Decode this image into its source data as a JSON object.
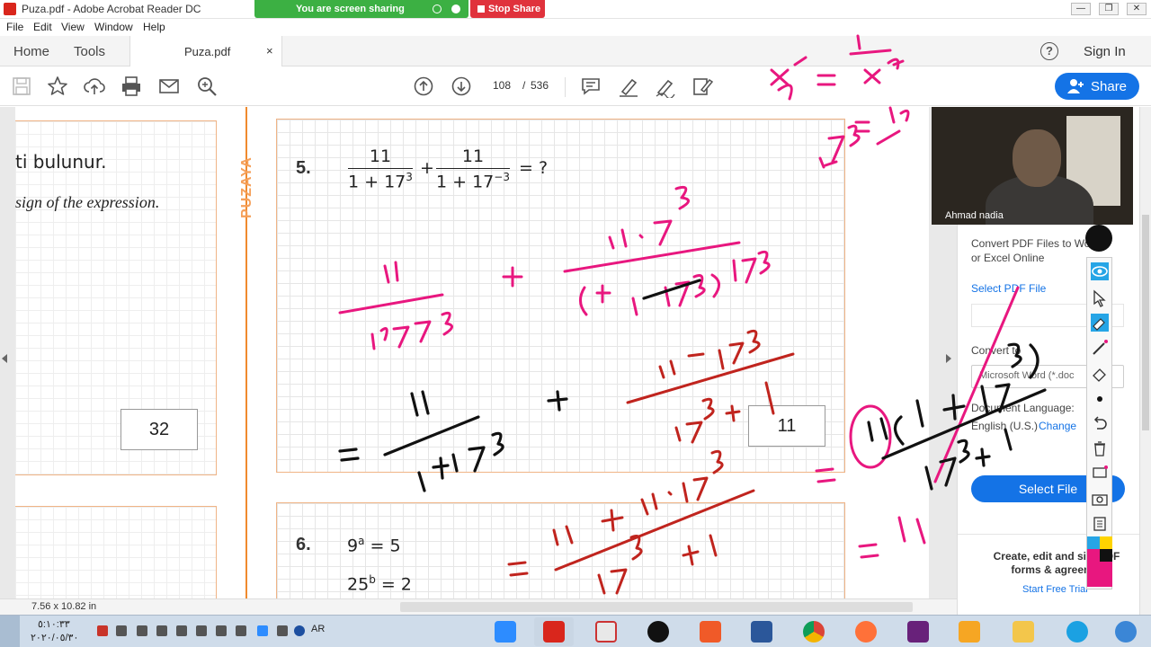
{
  "window": {
    "title": "Puza.pdf - Adobe Acrobat Reader DC",
    "minimize": "—",
    "restore": "❐",
    "close": "✕"
  },
  "screen_share": {
    "status": "You are screen sharing",
    "stop_label": "Stop Share"
  },
  "menu": [
    "File",
    "Edit",
    "View",
    "Window",
    "Help"
  ],
  "tabs": {
    "home": "Home",
    "tools": "Tools",
    "document": "Puza.pdf",
    "close": "×"
  },
  "header": {
    "help": "?",
    "sign_in": "Sign In"
  },
  "toolbar": {
    "page_current": "108",
    "page_separator": "/",
    "page_total": "536",
    "share_label": "Share",
    "icons": [
      "save-icon",
      "star-icon",
      "upload-icon",
      "print-icon",
      "mail-icon",
      "search-icon",
      "page-up-icon",
      "page-down-icon",
      "comment-icon",
      "highlight-icon",
      "sign-icon",
      "fill-sign-icon"
    ]
  },
  "document": {
    "left_text_line1": "ti bulunur.",
    "left_text_line2": "sign of the expression.",
    "brand_vertical": "PUZAYA",
    "left_answer": "32",
    "q5": {
      "number": "5.",
      "term1_num": "11",
      "term1_den": "1 + 17",
      "term1_exp": "3",
      "plus": "+",
      "term2_num": "11",
      "term2_den": "1 + 17",
      "term2_exp": "−3",
      "equals": "= ?",
      "answer": "11"
    },
    "q6": {
      "number": "6.",
      "line1_base": "9",
      "line1_exp": "a",
      "line1_rhs": " = 5",
      "line2_base": "25",
      "line2_exp": "b",
      "line2_rhs": " = 2"
    },
    "page_size": "7.56 x 10.82 in"
  },
  "right_panel": {
    "convert_text": "Convert PDF Files to Wo... or Excel Online",
    "convert_line1": "Convert PDF Files to Wo",
    "convert_line2": "or Excel Online",
    "select_pdf_link": "Select PDF File",
    "convert_to_label": "Convert to",
    "format_value": "Microsoft Word (*.doc",
    "document_language_label": "Document Language:",
    "language_value": "English (U.S.)",
    "change_link": "Change",
    "select_file_button": "Select File",
    "promo_line1": "Create, edit and si... PDF",
    "promo_line2": "forms & agreem...",
    "start_trial": "Start Free Trial"
  },
  "webcam": {
    "name": "Ahmad nadia"
  },
  "annotations": {
    "colors": {
      "pink": "#e8177f",
      "red": "#c0241e",
      "black": "#111111"
    },
    "strokes_text": [
      "11 . 17^3",
      "(1 + 1/17^3) 17^3",
      "11 / (1 + 17^3)",
      "11 . 17^3 / (17^3 + 1)",
      "11 / (1 + 17^3)",
      "11 + 11 . 17^3 / (17^3 + 1)",
      "11 (1 + 17^3) / (17^3 + 1)",
      "x^-a = 1 / x^a",
      "= 11"
    ]
  },
  "taskbar": {
    "time": "٥:١٠:٣٣",
    "date": "٢٠٢٠/٠٥/٣٠",
    "language": "AR",
    "apps": [
      "zoom",
      "acrobat",
      "snipping-tool",
      "pen-tool",
      "screencast",
      "word",
      "chrome",
      "firefox",
      "visual-studio",
      "video-player",
      "file-explorer",
      "internet-explorer",
      "windows-media"
    ]
  }
}
